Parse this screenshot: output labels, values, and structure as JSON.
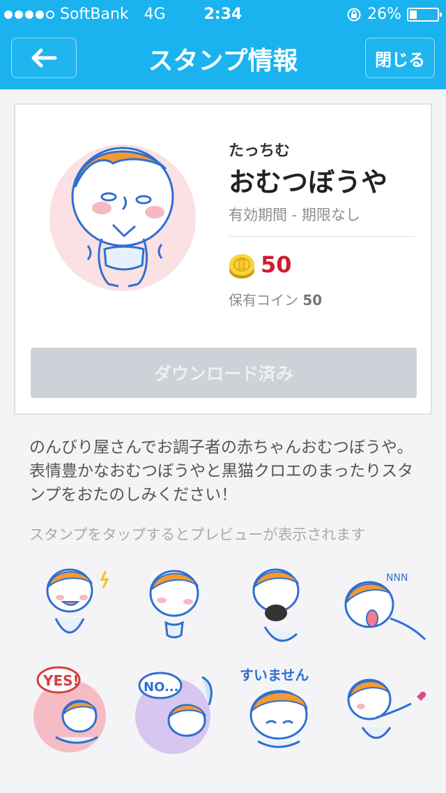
{
  "status_bar": {
    "carrier": "SoftBank",
    "network": "4G",
    "time": "2:34",
    "battery_percent": "26%",
    "battery_level": 0.26
  },
  "nav": {
    "back_icon": "left-arrow-icon",
    "title": "スタンプ情報",
    "close_label": "閉じる"
  },
  "sticker": {
    "author": "たっちむ",
    "title": "おむつぼうや",
    "validity": "有効期間 - 期限なし",
    "price": "50",
    "owned_label": "保有コイン",
    "owned_value": "50",
    "download_label": "ダウンロード済み"
  },
  "description": "のんびり屋さんでお調子者の赤ちゃんおむつぼうや。表情豊かなおむつぼうやと黒猫クロエのまったりスタンプをおたのしみください！",
  "preview_hint": "スタンプをタップするとプレビューが表示されます",
  "preview_stickers": [
    {
      "text": ""
    },
    {
      "text": ""
    },
    {
      "text": ""
    },
    {
      "text": "NNN"
    },
    {
      "text": "YES!"
    },
    {
      "text": "NO..."
    },
    {
      "text": "すいません"
    },
    {
      "text": ""
    }
  ],
  "colors": {
    "nav_bg": "#1ab3ef",
    "price": "#cc1f2c",
    "download_disabled": "#cdd1d8"
  }
}
